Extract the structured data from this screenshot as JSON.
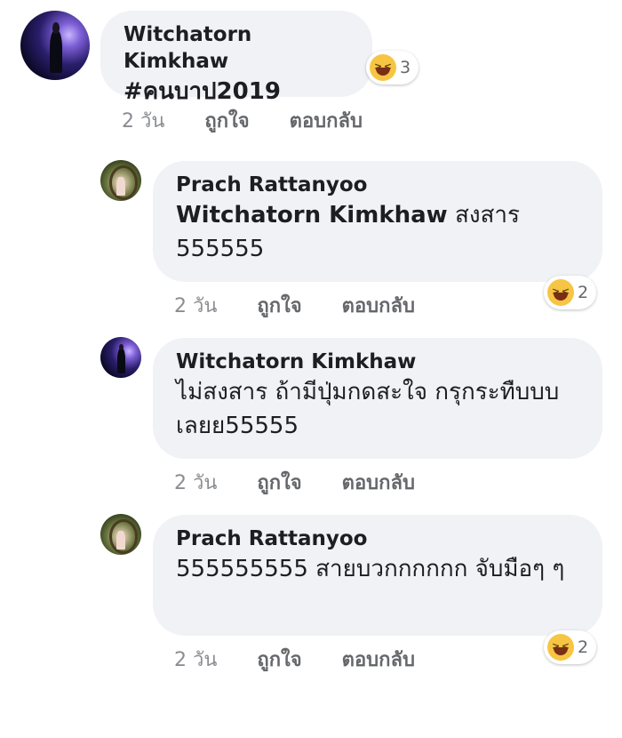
{
  "comments": [
    {
      "author": "Witchatorn Kimkhaw",
      "mention": "",
      "text": "#คนบาป2019",
      "time": "2 วัน",
      "like": "ถูกใจ",
      "reply": "ตอบกลับ",
      "reaction": {
        "icon": "haha-icon",
        "count": "3"
      }
    },
    {
      "author": "Prach Rattanyoo",
      "mention": "Witchatorn Kimkhaw",
      "text": " สงสาร 555555",
      "time": "2 วัน",
      "like": "ถูกใจ",
      "reply": "ตอบกลับ",
      "reaction": {
        "icon": "haha-icon",
        "count": "2"
      }
    },
    {
      "author": "Witchatorn Kimkhaw",
      "mention": "",
      "text": "ไม่สงสาร ถ้ามีปุ่มกดสะใจ กรุกระทืบบบเลยย55555",
      "time": "2 วัน",
      "like": "ถูกใจ",
      "reply": "ตอบกลับ"
    },
    {
      "author": "Prach Rattanyoo",
      "mention": "",
      "text": "555555555 สายบวกกกกกก จับมือๆ ๆ",
      "time": "2 วัน",
      "like": "ถูกใจ",
      "reply": "ตอบกลับ",
      "reaction": {
        "icon": "haha-icon",
        "count": "2"
      }
    }
  ],
  "colors": {
    "bubble": "#f0f2f5",
    "meta": "#65676b",
    "haha": "#f7c544"
  }
}
